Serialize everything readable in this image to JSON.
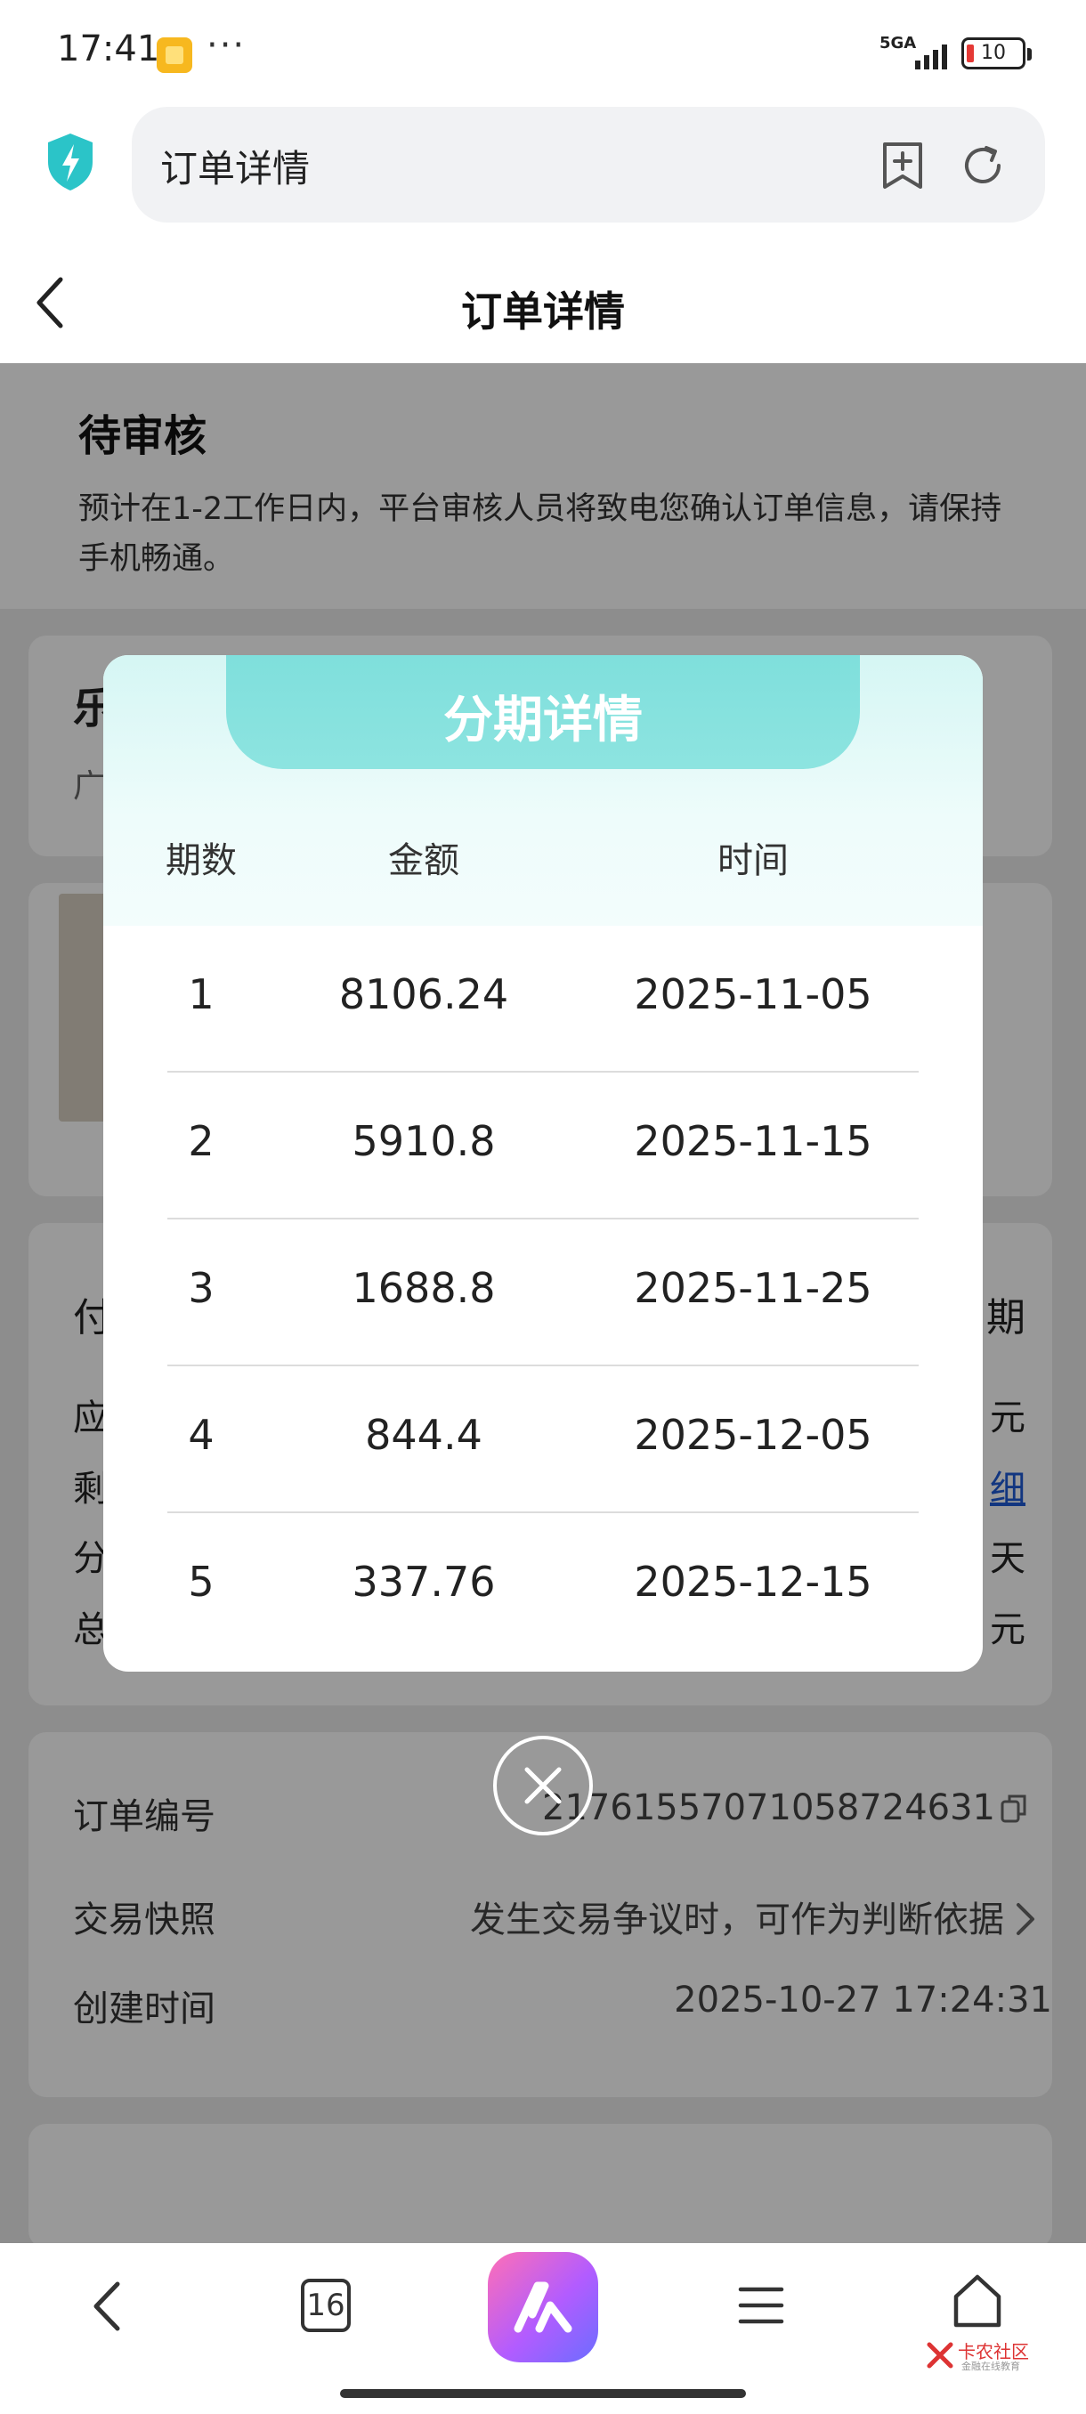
{
  "status_bar": {
    "time": "17:41",
    "dots": "···",
    "network": "5GA",
    "battery": "10"
  },
  "browser": {
    "url_title": "订单详情"
  },
  "header": {
    "title": "订单详情"
  },
  "order_status": {
    "title": "待审核",
    "description": "预计在1-2工作日内，平台审核人员将致电您确认订单信息，请保持手机畅通。"
  },
  "partial_cards": {
    "shop_initial": "乐",
    "shop_sub": "广",
    "pay_left": "付",
    "pay_right": "期",
    "row_left": [
      "应",
      "剩",
      "分",
      "总"
    ],
    "row_right": [
      "元",
      "细",
      "天",
      "元"
    ]
  },
  "order_info": {
    "order_no_label": "订单编号",
    "order_no_value": "2176155707105872463​1",
    "snapshot_label": "交易快照",
    "snapshot_value": "发生交易争议时，可作为判断依据",
    "created_label": "创建时间",
    "created_value": "2025-10-27 17:24:31"
  },
  "modal": {
    "title": "分期详情",
    "headers": [
      "期数",
      "金额",
      "时间"
    ],
    "rows": [
      {
        "period": "1",
        "amount": "8106.24",
        "date": "2025-11-05"
      },
      {
        "period": "2",
        "amount": "5910.8",
        "date": "2025-11-15"
      },
      {
        "period": "3",
        "amount": "1688.8",
        "date": "2025-11-25"
      },
      {
        "period": "4",
        "amount": "844.4",
        "date": "2025-12-05"
      },
      {
        "period": "5",
        "amount": "337.76",
        "date": "2025-12-15"
      }
    ]
  },
  "bottom_nav": {
    "tabs_count": "16",
    "watermark": "卡农社区",
    "watermark_sub": "金融在线教育"
  },
  "colors": {
    "accent": "#7fdfdc",
    "shield": "#2bc4c8",
    "overlay": "rgba(0,0,0,0.40)"
  }
}
